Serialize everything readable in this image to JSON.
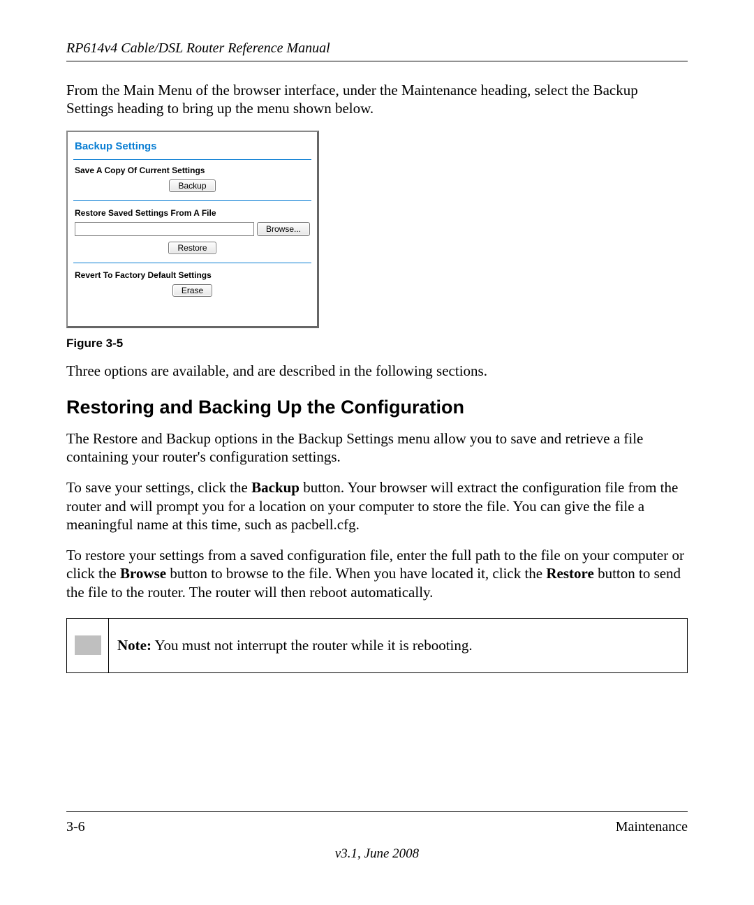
{
  "header": {
    "title": "RP614v4 Cable/DSL Router Reference Manual"
  },
  "intro": {
    "text": "From the Main Menu of the browser interface, under the Maintenance heading, select the Backup Settings heading to bring up the menu shown below."
  },
  "screenshot": {
    "title": "Backup Settings",
    "save_label": "Save A Copy Of Current Settings",
    "backup_btn": "Backup",
    "restore_label": "Restore Saved Settings From A File",
    "browse_btn": "Browse...",
    "restore_btn": "Restore",
    "revert_label": "Revert To Factory Default Settings",
    "erase_btn": "Erase",
    "file_value": ""
  },
  "figure_caption": "Figure 3-5",
  "after_figure": "Three options are available, and are described in the following sections.",
  "heading": "Restoring and Backing Up the Configuration",
  "para1": "The Restore and Backup options in the Backup Settings menu allow you to save and retrieve a file containing your router's configuration settings.",
  "para2": {
    "pre": "To save your settings, click the ",
    "bold": "Backup",
    "post": " button. Your browser will extract the configuration file from the router and will prompt you for a location on your computer to store the file. You can give the file a meaningful name at this time, such as pacbell.cfg."
  },
  "para3": {
    "pre": "To restore your settings from a saved configuration file, enter the full path to the file on your computer or click the ",
    "bold1": "Browse",
    "mid": " button to browse to the file. When you have located it, click the ",
    "bold2": "Restore",
    "post": " button to send the file to the router. The router will then reboot automatically."
  },
  "note": {
    "label": "Note:",
    "text": " You must not interrupt the router while it is rebooting."
  },
  "footer": {
    "page": "3-6",
    "chapter": "Maintenance",
    "version": "v3.1, June 2008"
  }
}
